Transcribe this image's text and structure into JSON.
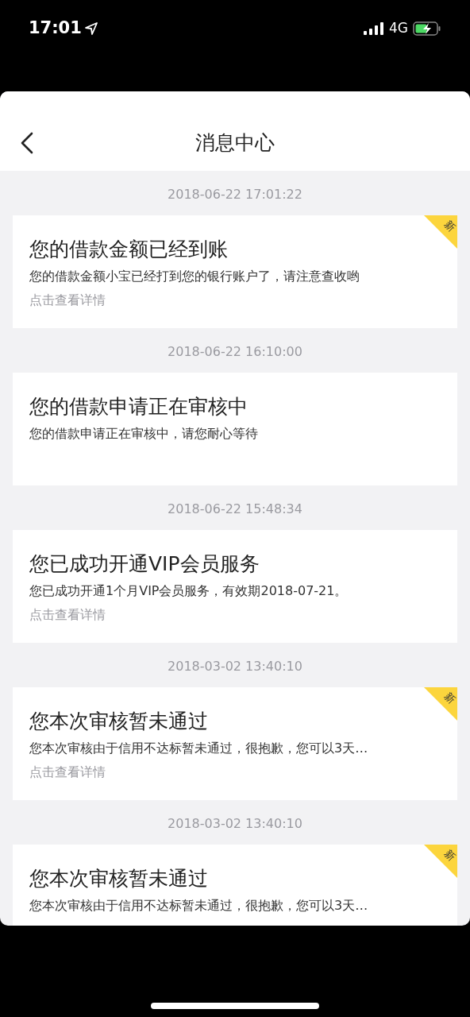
{
  "status_bar": {
    "time": "17:01",
    "network": "4G"
  },
  "header": {
    "title": "消息中心"
  },
  "messages": [
    {
      "date": "2018-06-22 17:01:22",
      "title": "您的借款金额已经到账",
      "body": "您的借款金额小宝已经打到您的银行账户了，请注意查收哟",
      "link": "点击查看详情",
      "new": true,
      "badge": "新"
    },
    {
      "date": "2018-06-22 16:10:00",
      "title": "您的借款申请正在审核中",
      "body": "您的借款申请正在审核中，请您耐心等待",
      "new": false
    },
    {
      "date": "2018-06-22 15:48:34",
      "title": "您已成功开通VIP会员服务",
      "body": "您已成功开通1个月VIP会员服务，有效期2018-07-21。",
      "link": "点击查看详情",
      "new": false
    },
    {
      "date": "2018-03-02 13:40:10",
      "title": "您本次审核暂未通过",
      "body": "您本次审核由于信用不达标暂未通过，很抱歉，您可以3天…",
      "link": "点击查看详情",
      "new": true,
      "badge": "新"
    },
    {
      "date": "2018-03-02 13:40:10",
      "title": "您本次审核暂未通过",
      "body": "您本次审核由于信用不达标暂未通过，很抱歉，您可以3天…",
      "new": true,
      "badge": "新"
    }
  ]
}
